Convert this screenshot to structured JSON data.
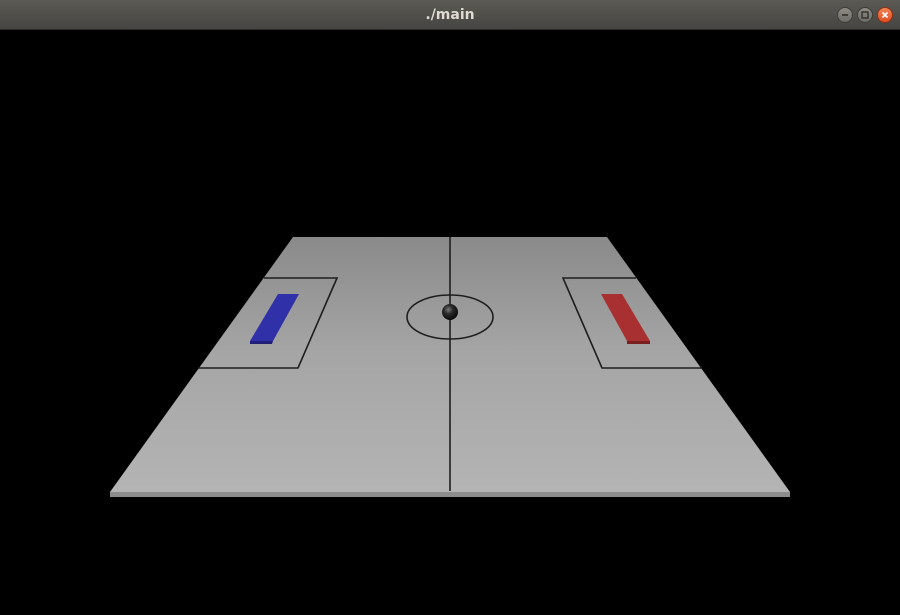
{
  "window": {
    "title": "./main"
  },
  "controls": {
    "minimize_icon": "minimize-icon",
    "maximize_icon": "maximize-icon",
    "close_icon": "close-icon"
  },
  "scene": {
    "background_color": "#000000",
    "field_color": "#b1b1b1",
    "line_color": "#1e1e1e",
    "left_paddle_color": "#3030a8",
    "right_paddle_color": "#a83030",
    "ball_color": "#111111"
  }
}
